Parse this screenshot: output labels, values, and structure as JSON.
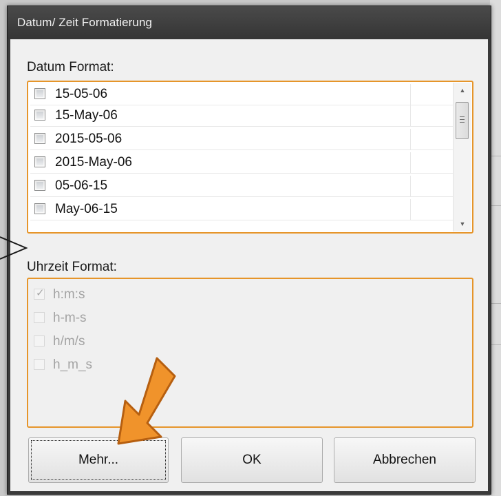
{
  "window": {
    "title": "Datum/ Zeit Formatierung"
  },
  "date_group": {
    "label": "Datum Format:",
    "items": [
      {
        "label": "15-05-06",
        "checked": false
      },
      {
        "label": "15-May-06",
        "checked": false
      },
      {
        "label": "2015-05-06",
        "checked": false
      },
      {
        "label": "2015-May-06",
        "checked": false
      },
      {
        "label": "05-06-15",
        "checked": false
      },
      {
        "label": "May-06-15",
        "checked": false
      }
    ]
  },
  "time_group": {
    "label": "Uhrzeit Format:",
    "enabled": false,
    "items": [
      {
        "label": "h:m:s",
        "checked": true
      },
      {
        "label": "h-m-s",
        "checked": false
      },
      {
        "label": "h/m/s",
        "checked": false
      },
      {
        "label": "h_m_s",
        "checked": false
      }
    ]
  },
  "buttons": {
    "more": "Mehr...",
    "ok": "OK",
    "cancel": "Abbrechen"
  },
  "colors": {
    "accent_border": "#e6952a",
    "annotation_arrow": "#f0932b",
    "titlebar": "#3a3a3a"
  },
  "icons": {
    "scroll_up": "triangle-up",
    "scroll_down": "triangle-down",
    "check": "check-mark"
  }
}
